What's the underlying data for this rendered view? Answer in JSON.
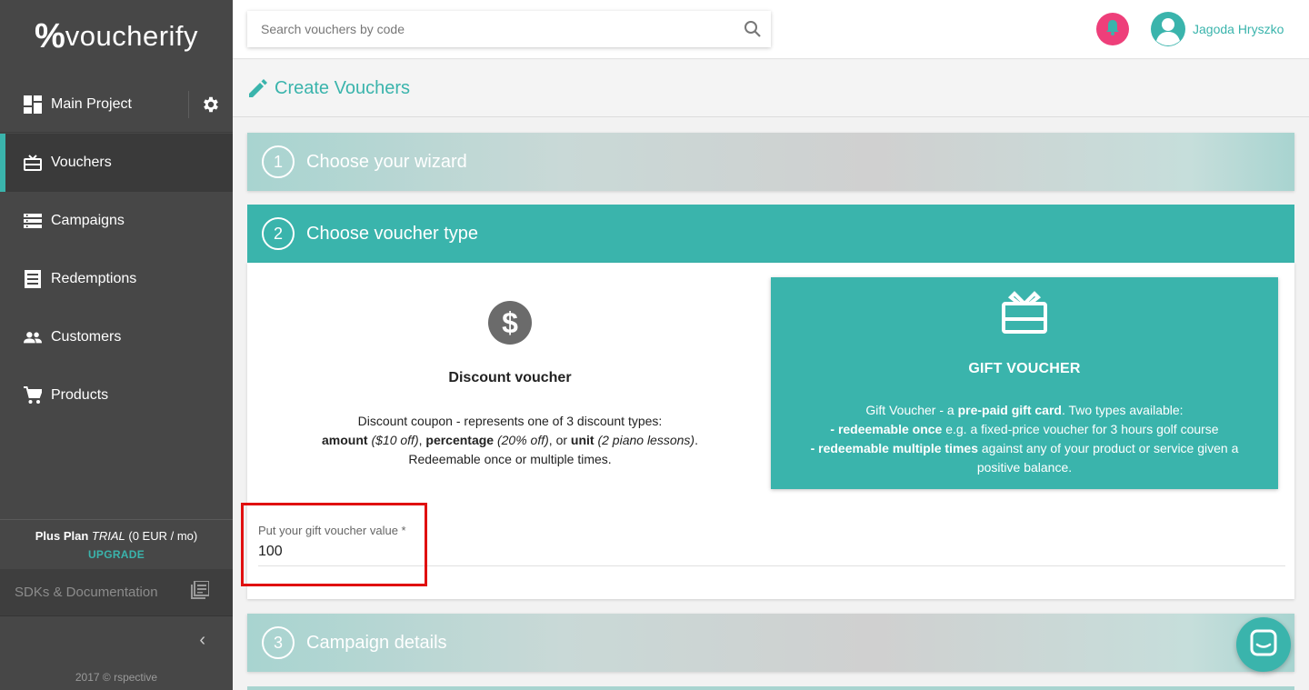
{
  "sidebar": {
    "logo_mark": "%",
    "logo_text": "voucherify",
    "project_label": "Main Project",
    "items": [
      {
        "label": "Vouchers",
        "icon": "gift-card-icon",
        "active": true
      },
      {
        "label": "Campaigns",
        "icon": "list-icon",
        "active": false
      },
      {
        "label": "Redemptions",
        "icon": "receipt-icon",
        "active": false
      },
      {
        "label": "Customers",
        "icon": "people-icon",
        "active": false
      },
      {
        "label": "Products",
        "icon": "cart-icon",
        "active": false
      }
    ],
    "plan": {
      "name": "Plus Plan",
      "trial": "TRIAL",
      "price": "(0 EUR / mo)",
      "upgrade": "UPGRADE"
    },
    "sdk_label": "SDKs & Documentation",
    "collapse": "‹",
    "copyright": "2017 © rspective"
  },
  "topbar": {
    "search_placeholder": "Search vouchers by code",
    "user_name": "Jagoda Hryszko"
  },
  "page": {
    "title": "Create Vouchers"
  },
  "steps": [
    {
      "num": "1",
      "title": "Choose your wizard"
    },
    {
      "num": "2",
      "title": "Choose voucher type"
    },
    {
      "num": "3",
      "title": "Campaign details"
    }
  ],
  "discount": {
    "title": "Discount voucher",
    "line1": "Discount coupon - represents one of 3 discount types:",
    "amount": "amount",
    "amount_ex": "($10 off)",
    "percentage": "percentage",
    "percentage_ex": "(20% off)",
    "unit": "unit",
    "unit_ex": "(2 piano lessons)",
    "sep1": ", ",
    "sep2": ", or ",
    "end": ".",
    "line3": "Redeemable once or multiple times."
  },
  "gift": {
    "title": "GIFT VOUCHER",
    "intro_prefix": "Gift Voucher - a ",
    "intro_bold": "pre-paid gift card",
    "intro_suffix": ". Two types available:",
    "once_bold": "- redeemable once",
    "once_rest": " e.g. a fixed-price voucher for 3 hours golf course",
    "multi_bold": "- redeemable multiple times",
    "multi_rest": " against any of your product or service given a positive balance."
  },
  "value_field": {
    "label": "Put your gift voucher value *",
    "value": "100"
  },
  "colors": {
    "accent": "#3ab4ac",
    "sidebar": "#474747",
    "bell": "#ee3f7a",
    "highlight": "#e01010"
  }
}
